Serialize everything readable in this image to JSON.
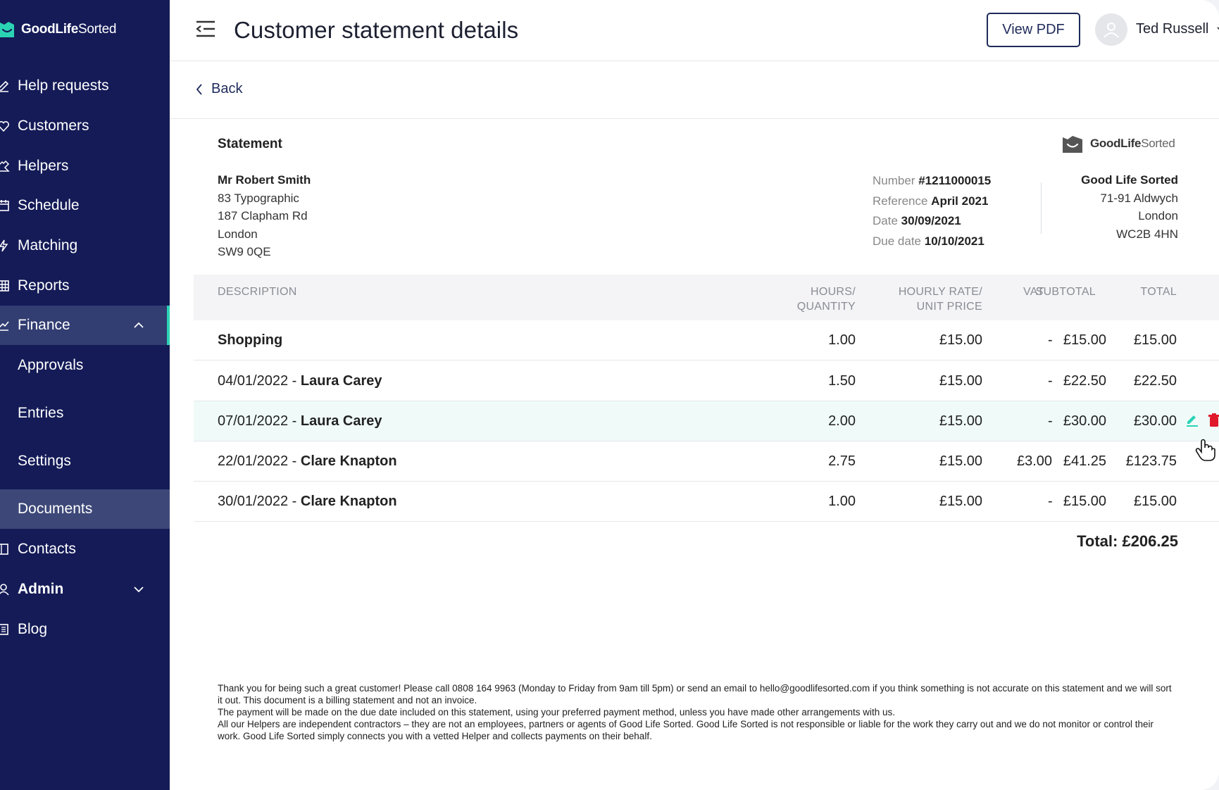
{
  "app": {
    "brand_bold": "GoodLife",
    "brand_light": "Sorted"
  },
  "sidebar": {
    "items": [
      {
        "label": "Help requests"
      },
      {
        "label": "Customers"
      },
      {
        "label": "Helpers"
      },
      {
        "label": "Schedule"
      },
      {
        "label": "Matching"
      },
      {
        "label": "Reports"
      },
      {
        "label": "Finance"
      },
      {
        "label": "Approvals"
      },
      {
        "label": "Entries"
      },
      {
        "label": "Settings"
      },
      {
        "label": "Documents"
      },
      {
        "label": "Contacts"
      },
      {
        "label": "Admin"
      },
      {
        "label": "Blog"
      }
    ],
    "accent_color": "#2bd3b5",
    "bg_color": "#141b57"
  },
  "header": {
    "title": "Customer statement details",
    "view_pdf_label": "View PDF",
    "user_name": "Ted Russell"
  },
  "back_label": "Back",
  "statement": {
    "title": "Statement",
    "brand_bold": "GoodLife",
    "brand_light": "Sorted",
    "customer": {
      "name": "Mr Robert Smith",
      "line1": "83 Typographic",
      "line2": "187 Clapham Rd",
      "city": "London",
      "postcode": "SW9 0QE"
    },
    "meta": {
      "number_label": "Number",
      "number": "#1211000015",
      "reference_label": "Reference",
      "reference": "April 2021",
      "date_label": "Date",
      "date": "30/09/2021",
      "due_label": "Due date",
      "due": "10/10/2021"
    },
    "company": {
      "name": "Good Life Sorted",
      "line1": "71-91 Aldwych",
      "city": "London",
      "postcode": "WC2B 4HN"
    }
  },
  "table": {
    "headers": {
      "description": "DESCRIPTION",
      "hours_1": "HOURS/",
      "hours_2": "QUANTITY",
      "rate_1": "HOURLY RATE/",
      "rate_2": "UNIT PRICE",
      "subtotal": "SUBTOTAL",
      "vat": "VAT",
      "total": "TOTAL"
    },
    "rows": [
      {
        "date": "",
        "sep": "",
        "name": "Shopping",
        "qty": "1.00",
        "rate": "£15.00",
        "subtotal": "£15.00",
        "vat": "-",
        "total": "£15.00"
      },
      {
        "date": "04/01/2022",
        "sep": " - ",
        "name": "Laura Carey",
        "qty": "1.50",
        "rate": "£15.00",
        "subtotal": "£22.50",
        "vat": "-",
        "total": "£22.50"
      },
      {
        "date": "07/01/2022",
        "sep": " - ",
        "name": "Laura Carey",
        "qty": "2.00",
        "rate": "£15.00",
        "subtotal": "£30.00",
        "vat": "-",
        "total": "£30.00"
      },
      {
        "date": "22/01/2022",
        "sep": " - ",
        "name": "Clare Knapton",
        "qty": "2.75",
        "rate": "£15.00",
        "subtotal": "£41.25",
        "vat": "£3.00",
        "total": "£123.75"
      },
      {
        "date": "30/01/2022",
        "sep": " - ",
        "name": "Clare Knapton",
        "qty": "1.00",
        "rate": "£15.00",
        "subtotal": "£15.00",
        "vat": "-",
        "total": "£15.00"
      }
    ],
    "grand_total": "Total: £206.25",
    "highlight_color": "#f0fbf9",
    "edit_icon_color": "#2bd3b5",
    "delete_icon_color": "#e0192b"
  },
  "footer": {
    "p1": "Thank you for being such a great customer! Please call 0808 164 9963 (Monday to Friday from 9am till 5pm) or send an email to hello@goodlifesorted.com if you think something is not accurate on this statement and we will sort it out. This document is a billing statement and not an invoice.",
    "p2": "The payment will be made on the due date included on this statement, using your preferred payment method, unless you have made other arrangements with us.",
    "p3": "All our Helpers are independent contractors – they are not an employees, partners or agents of Good Life Sorted. Good Life Sorted is not responsible or liable for the work they carry out and we do not monitor or control their work. Good Life Sorted simply connects you with a vetted Helper and collects payments on their behalf."
  }
}
